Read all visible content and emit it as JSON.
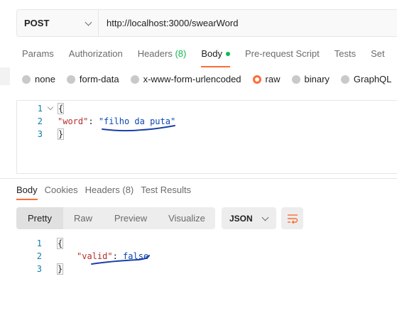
{
  "request": {
    "method": "POST",
    "url": "http://localhost:3000/swearWord"
  },
  "request_tabs": [
    {
      "label": "Params"
    },
    {
      "label": "Authorization"
    },
    {
      "label": "Headers",
      "count": "(8)"
    },
    {
      "label": "Body"
    },
    {
      "label": "Pre-request Script"
    },
    {
      "label": "Tests"
    },
    {
      "label": "Set"
    }
  ],
  "body_types": [
    {
      "label": "none"
    },
    {
      "label": "form-data"
    },
    {
      "label": "x-www-form-urlencoded"
    },
    {
      "label": "raw"
    },
    {
      "label": "binary"
    },
    {
      "label": "GraphQL"
    }
  ],
  "request_body": {
    "line_numbers": [
      "1",
      "2",
      "3"
    ],
    "open_brace": "{",
    "key": "\"word\"",
    "colon": ":",
    "value": "\"filho da puta\"",
    "close_brace": "}"
  },
  "response_tabs": [
    {
      "label": "Body"
    },
    {
      "label": "Cookies"
    },
    {
      "label": "Headers",
      "count": "(8)"
    },
    {
      "label": "Test Results"
    }
  ],
  "view_modes": [
    {
      "label": "Pretty"
    },
    {
      "label": "Raw"
    },
    {
      "label": "Preview"
    },
    {
      "label": "Visualize"
    }
  ],
  "format": {
    "selected": "JSON"
  },
  "response_body": {
    "line_numbers": [
      "1",
      "2",
      "3"
    ],
    "open_brace": "{",
    "key": "\"valid\"",
    "colon": ":",
    "value": "false",
    "close_brace": "}"
  },
  "colors": {
    "accent": "#ff6c37",
    "status_green": "#0cbb52",
    "json_key": "#b5302b",
    "json_value": "#0b47b4",
    "annotation_ink": "#1a3fa8"
  },
  "icons": {
    "method_dropdown": "chevron-down-icon",
    "format_dropdown": "chevron-down-icon",
    "wrap_lines": "wrap-lines-icon",
    "fold": "fold-arrow-icon"
  }
}
